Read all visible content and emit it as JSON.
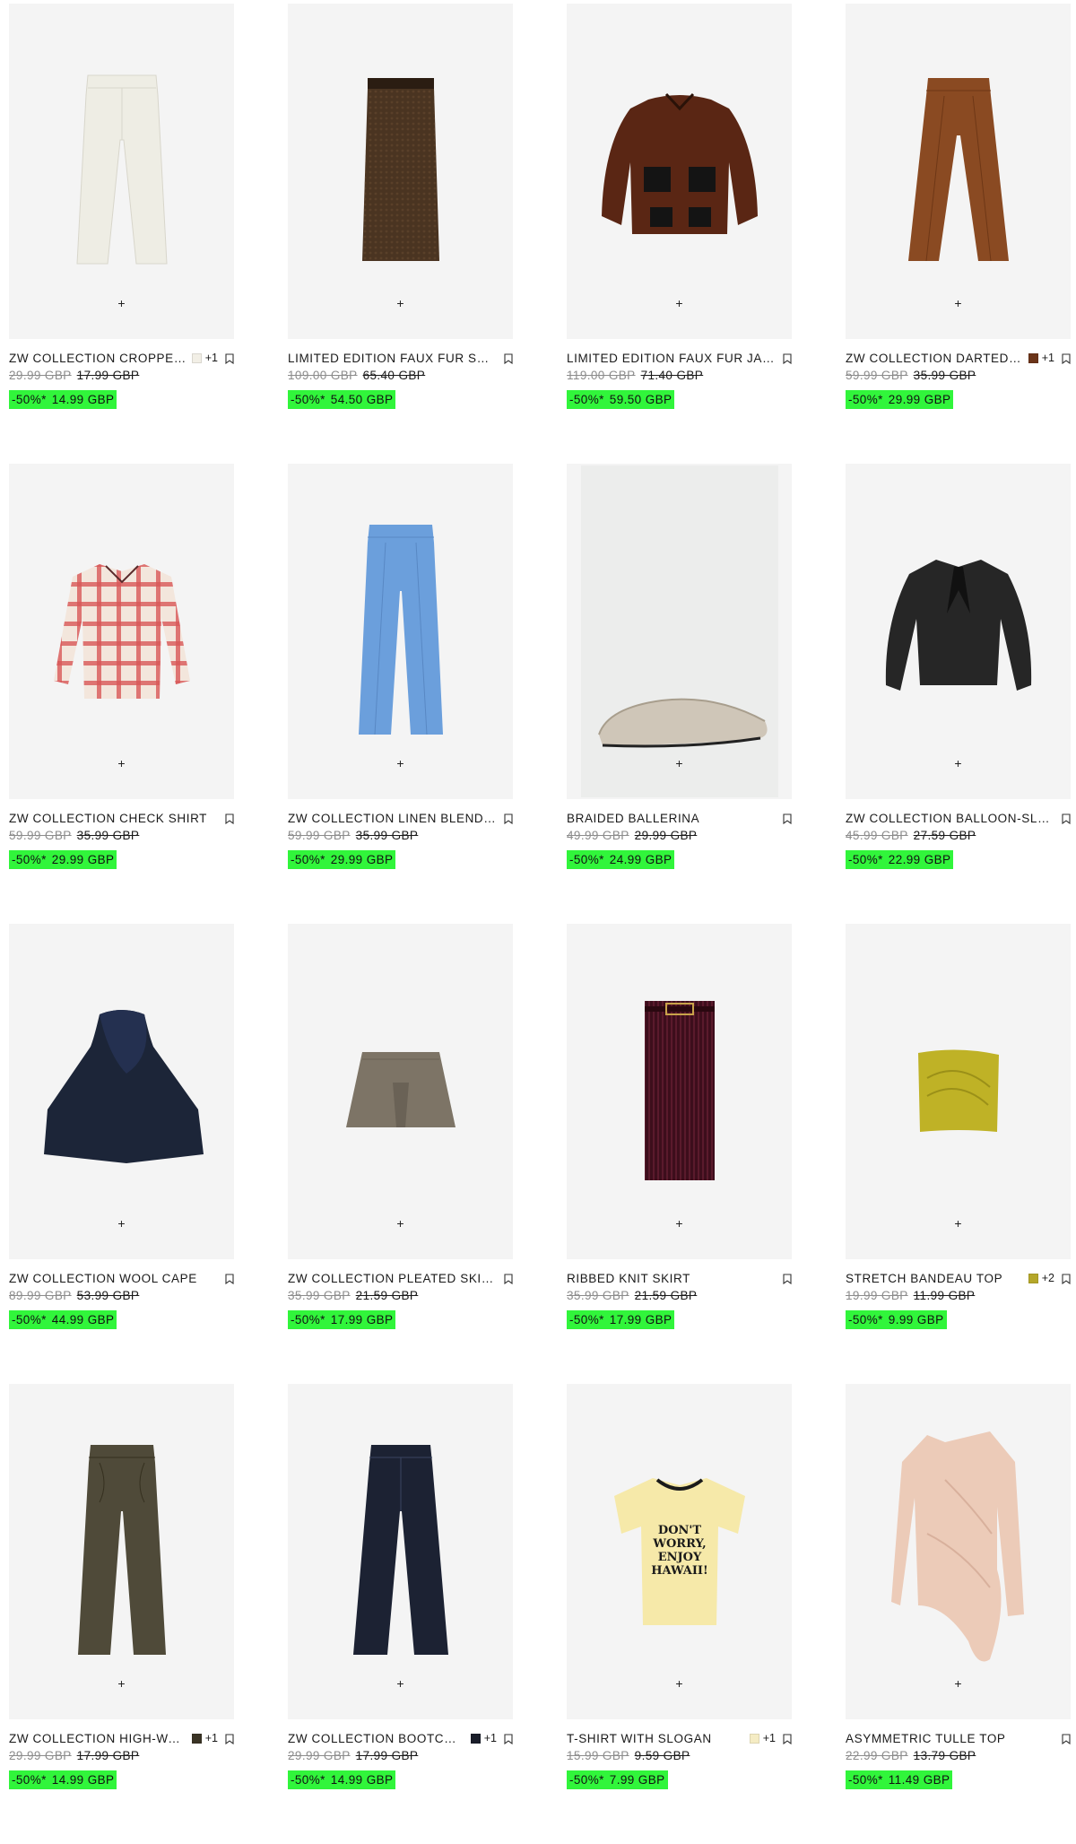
{
  "add_symbol": "+",
  "products": [
    {
      "name": "ZW COLLECTION CROPPED MID-RISE JEANS",
      "swatch": "#f2efe6",
      "more": "+1",
      "orig": "29.99 GBP",
      "prev": "17.99 GBP",
      "discount": "-50%*",
      "sale": "14.99 GBP",
      "art": "jeans-white"
    },
    {
      "name": "LIMITED EDITION FAUX FUR SKIRT",
      "swatch": null,
      "more": "",
      "orig": "109.00 GBP",
      "prev": "65.40 GBP",
      "discount": "-50%*",
      "sale": "54.50 GBP",
      "art": "skirt-fur"
    },
    {
      "name": "LIMITED EDITION FAUX FUR JACKET",
      "swatch": null,
      "more": "",
      "orig": "119.00 GBP",
      "prev": "71.40 GBP",
      "discount": "-50%*",
      "sale": "59.50 GBP",
      "art": "jacket-fur"
    },
    {
      "name": "ZW COLLECTION DARTED TROUSERS",
      "swatch": "#6b3419",
      "more": "+1",
      "orig": "59.99 GBP",
      "prev": "35.99 GBP",
      "discount": "-50%*",
      "sale": "29.99 GBP",
      "art": "trousers-brown"
    },
    {
      "name": "ZW COLLECTION CHECK SHIRT",
      "swatch": null,
      "more": "",
      "orig": "59.99 GBP",
      "prev": "35.99 GBP",
      "discount": "-50%*",
      "sale": "29.99 GBP",
      "art": "shirt-check"
    },
    {
      "name": "ZW COLLECTION LINEN BLEND TROUSERS",
      "swatch": null,
      "more": "",
      "orig": "59.99 GBP",
      "prev": "35.99 GBP",
      "discount": "-50%*",
      "sale": "29.99 GBP",
      "art": "trousers-blue"
    },
    {
      "name": "BRAIDED BALLERINA",
      "swatch": null,
      "more": "",
      "orig": "49.99 GBP",
      "prev": "29.99 GBP",
      "discount": "-50%*",
      "sale": "24.99 GBP",
      "art": "ballerina"
    },
    {
      "name": "ZW COLLECTION BALLOON-SLEEVE BLOUSE",
      "swatch": null,
      "more": "",
      "orig": "45.99 GBP",
      "prev": "27.59 GBP",
      "discount": "-50%*",
      "sale": "22.99 GBP",
      "art": "blouse-black"
    },
    {
      "name": "ZW COLLECTION WOOL CAPE",
      "swatch": null,
      "more": "",
      "orig": "89.99 GBP",
      "prev": "53.99 GBP",
      "discount": "-50%*",
      "sale": "44.99 GBP",
      "art": "cape-navy"
    },
    {
      "name": "ZW COLLECTION PLEATED SKIRT",
      "swatch": null,
      "more": "",
      "orig": "35.99 GBP",
      "prev": "21.59 GBP",
      "discount": "-50%*",
      "sale": "17.99 GBP",
      "art": "skirt-mini"
    },
    {
      "name": "RIBBED KNIT SKIRT",
      "swatch": null,
      "more": "",
      "orig": "35.99 GBP",
      "prev": "21.59 GBP",
      "discount": "-50%*",
      "sale": "17.99 GBP",
      "art": "skirt-knit"
    },
    {
      "name": "STRETCH BANDEAU TOP",
      "swatch": "#b5a72a",
      "more": "+2",
      "orig": "19.99 GBP",
      "prev": "11.99 GBP",
      "discount": "-50%*",
      "sale": "9.99 GBP",
      "art": "bandeau"
    },
    {
      "name": "ZW COLLECTION HIGH-WAIST TROUSERS",
      "swatch": "#3a3425",
      "more": "+1",
      "orig": "29.99 GBP",
      "prev": "17.99 GBP",
      "discount": "-50%*",
      "sale": "14.99 GBP",
      "art": "trousers-leather"
    },
    {
      "name": "ZW COLLECTION BOOTCUT JEANS",
      "swatch": "#1a1e2a",
      "more": "+1",
      "orig": "29.99 GBP",
      "prev": "17.99 GBP",
      "discount": "-50%*",
      "sale": "14.99 GBP",
      "art": "jeans-dark"
    },
    {
      "name": "T-SHIRT WITH SLOGAN",
      "swatch": "#f5ecc4",
      "more": "+1",
      "orig": "15.99 GBP",
      "prev": "9.59 GBP",
      "discount": "-50%*",
      "sale": "7.99 GBP",
      "art": "tshirt",
      "tshirt_text": [
        "DON'T",
        "WORRY,",
        "ENJOY",
        "HAWAII!"
      ]
    },
    {
      "name": "ASYMMETRIC TULLE TOP",
      "swatch": null,
      "more": "",
      "orig": "22.99 GBP",
      "prev": "13.79 GBP",
      "discount": "-50%*",
      "sale": "11.49 GBP",
      "art": "tulle-top"
    }
  ]
}
